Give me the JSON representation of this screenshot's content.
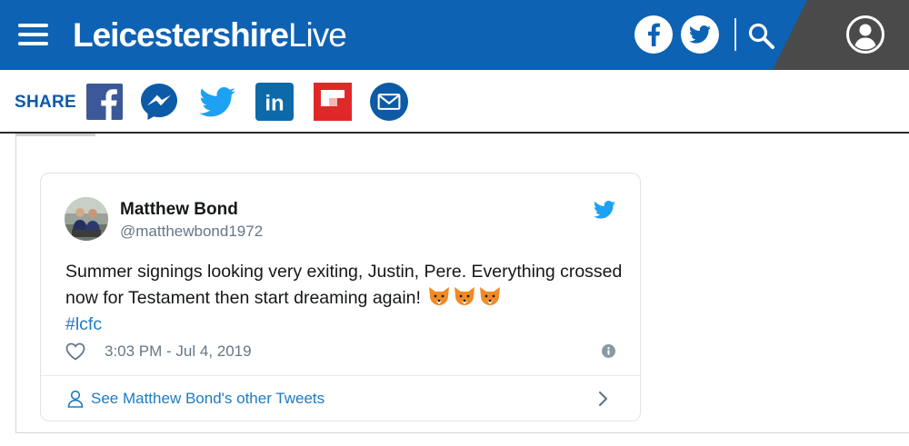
{
  "header": {
    "brand_bold": "Leicestershire",
    "brand_light": "Live",
    "icons": [
      "menu-icon",
      "facebook-icon",
      "twitter-icon",
      "search-icon",
      "user-icon"
    ],
    "colors": {
      "bar": "#0d62b4",
      "account_area": "#4a4a4a"
    }
  },
  "share": {
    "label": "SHARE",
    "buttons": [
      "facebook",
      "messenger",
      "twitter",
      "linkedin",
      "flipboard",
      "email"
    ]
  },
  "tweet": {
    "author_name": "Matthew Bond",
    "author_handle": "@matthewbond1972",
    "text": "Summer signings looking very exiting, Justin, Pere. Everything crossed now for Testament then start dreaming again!",
    "emoji": "🦊🦊🦊",
    "hashtag": "#lcfc",
    "timestamp": "3:03 PM - Jul 4, 2019",
    "more_tweets_label": "See Matthew Bond's other Tweets",
    "colors": {
      "link": "#1b7cc1",
      "muted": "#657786"
    }
  }
}
